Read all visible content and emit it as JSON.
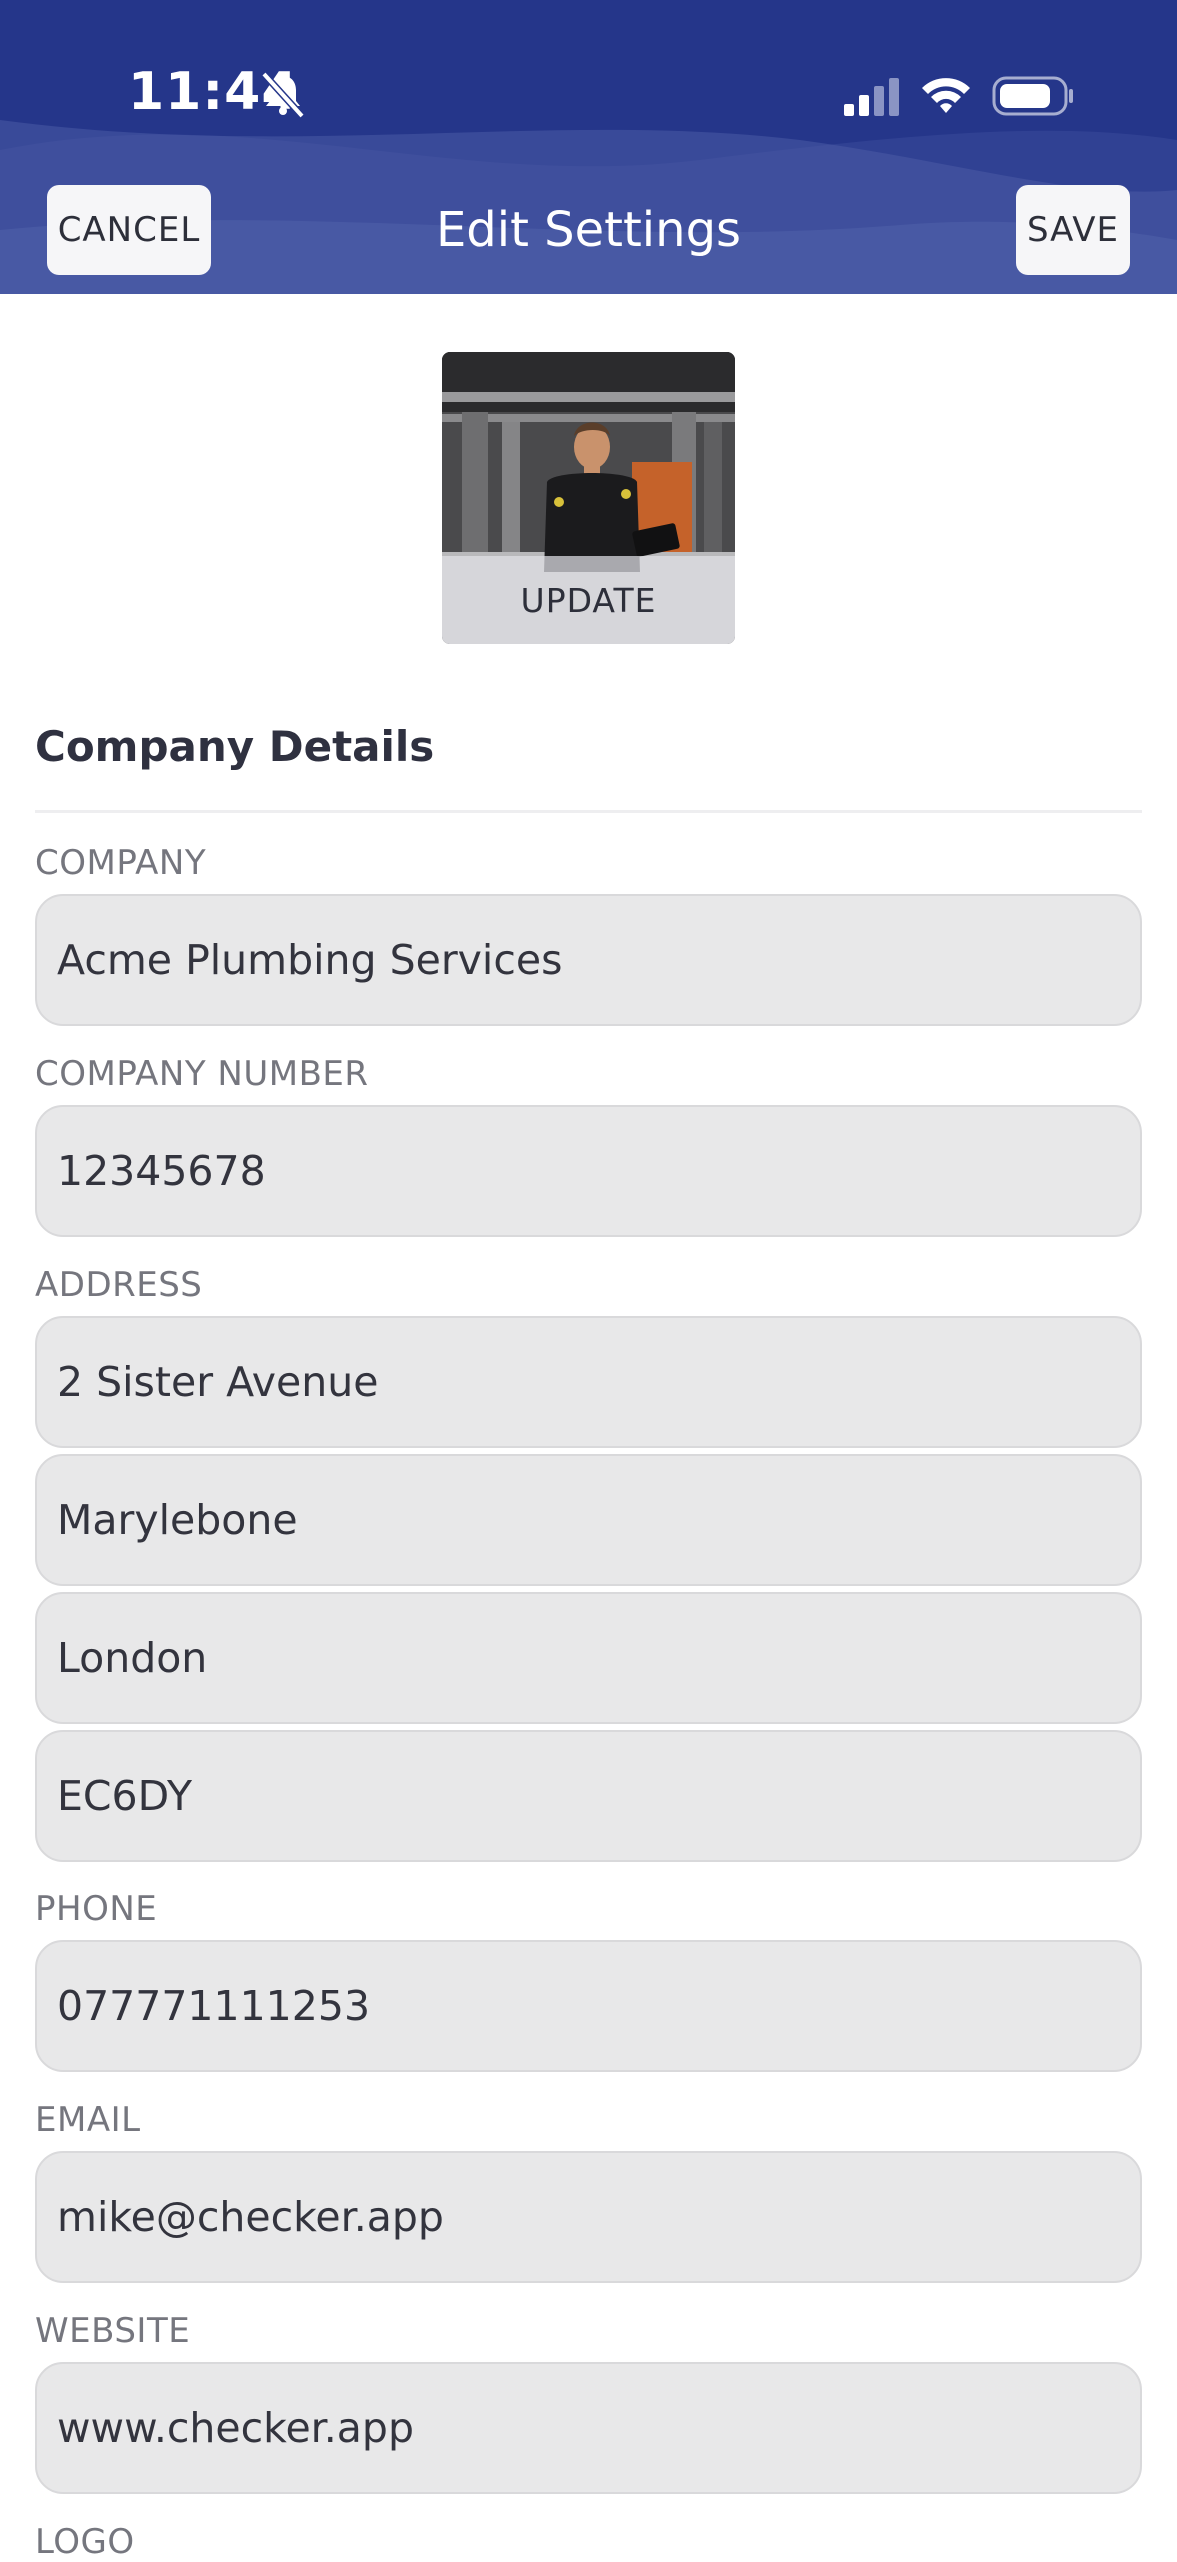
{
  "status_bar": {
    "time": "11:44",
    "icons": [
      "bell-slash-icon",
      "cellular-signal-icon",
      "wifi-icon",
      "battery-icon"
    ]
  },
  "nav": {
    "cancel_label": "CANCEL",
    "title": "Edit Settings",
    "save_label": "SAVE"
  },
  "photo": {
    "update_label": "UPDATE"
  },
  "section": {
    "title": "Company Details"
  },
  "fields": {
    "company_label": "COMPANY",
    "company_value": "Acme Plumbing Services",
    "company_number_label": "COMPANY NUMBER",
    "company_number_value": "12345678",
    "address_label": "ADDRESS",
    "address_line1": "2 Sister Avenue",
    "address_line2": "Marylebone",
    "address_line3": "London",
    "address_line4": "EC6DY",
    "phone_label": "PHONE",
    "phone_value": "077771111253",
    "email_label": "EMAIL",
    "email_value": "mike@checker.app",
    "website_label": "WEBSITE",
    "website_value": "www.checker.app",
    "logo_label": "LOGO"
  },
  "colors": {
    "header_bg": "#25368a",
    "field_bg": "#e8e8e9",
    "label_text": "#75767e"
  }
}
